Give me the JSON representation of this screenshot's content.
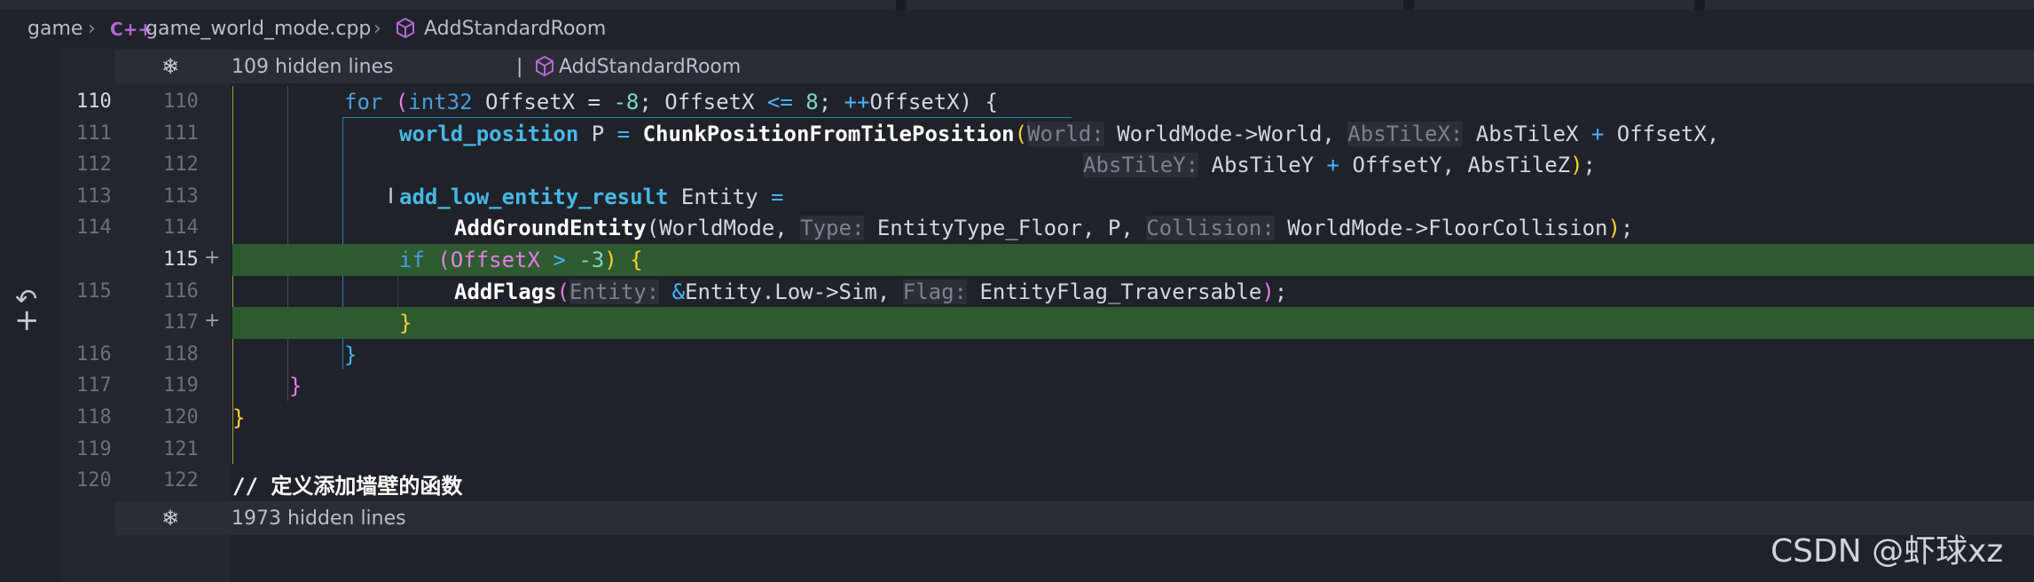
{
  "breadcrumb": {
    "root": "game",
    "file_icon": "C++",
    "file": "game_world_mode.cpp",
    "symbol": "AddStandardRoom"
  },
  "fold_top": {
    "text": "109 hidden lines",
    "separator": "|",
    "symbol": "AddStandardRoom"
  },
  "fold_bottom": {
    "text": "1973 hidden lines"
  },
  "watermark": "CSDN @虾球xz",
  "lines": [
    {
      "ln1": "110",
      "ln2": "110",
      "active": true
    },
    {
      "ln1": "111",
      "ln2": "111"
    },
    {
      "ln1": "112",
      "ln2": "112"
    },
    {
      "ln1": "113",
      "ln2": "113"
    },
    {
      "ln1": "114",
      "ln2": "114"
    },
    {
      "ln1": "",
      "ln2": "115",
      "mark": "+",
      "added": true
    },
    {
      "ln1": "115",
      "ln2": "116"
    },
    {
      "ln1": "",
      "ln2": "117",
      "mark": "+",
      "added": true
    },
    {
      "ln1": "116",
      "ln2": "118"
    },
    {
      "ln1": "117",
      "ln2": "119"
    },
    {
      "ln1": "118",
      "ln2": "120"
    },
    {
      "ln1": "119",
      "ln2": "121"
    },
    {
      "ln1": "120",
      "ln2": "122"
    }
  ],
  "code": {
    "l110": [
      "for",
      " (",
      "int32",
      " OffsetX = ",
      "-8",
      "; OffsetX ",
      "<=",
      " ",
      "8",
      "; ",
      "++",
      "OffsetX) {"
    ],
    "l111": [
      "world_position",
      " P ",
      "=",
      " ",
      "ChunkPositionFromTilePosition",
      "(",
      "World:",
      " WorldMode->World, ",
      "AbsTileX:",
      " AbsTileX ",
      "+",
      " OffsetX,"
    ],
    "l112": [
      "AbsTileY:",
      " AbsTileY ",
      "+",
      " OffsetY, AbsTileZ",
      ")",
      ";"
    ],
    "l113": [
      "add_low_entity_result",
      " Entity ",
      "="
    ],
    "l114": [
      "AddGroundEntity",
      "(WorldMode, ",
      "Type:",
      " EntityType_Floor, P, ",
      "Collision:",
      " WorldMode->FloorCollision",
      ")",
      ";"
    ],
    "l115": [
      "if",
      " (OffsetX ",
      ">",
      " ",
      "-3",
      ") {"
    ],
    "l116": [
      "AddFlags",
      "(",
      "Entity:",
      " ",
      "&",
      "Entity.Low->Sim, ",
      "Flag:",
      " EntityFlag_Traversable",
      ")",
      ";"
    ],
    "l117": [
      "}"
    ],
    "l118": [
      "}"
    ],
    "l119": [
      "}"
    ],
    "l120": [
      "}"
    ],
    "l122": [
      "// 定义添加墙壁的函数"
    ]
  },
  "colors": {
    "background": "#1f2229",
    "added_line": "#2e5a30",
    "keyword": "#4a9edd",
    "type": "#47b8e6",
    "function": "#ffffff",
    "number": "#7fd6c9",
    "bracket_gold": "#ffd22f",
    "bracket_pink": "#e57fe6",
    "hint": "#7d828d"
  }
}
